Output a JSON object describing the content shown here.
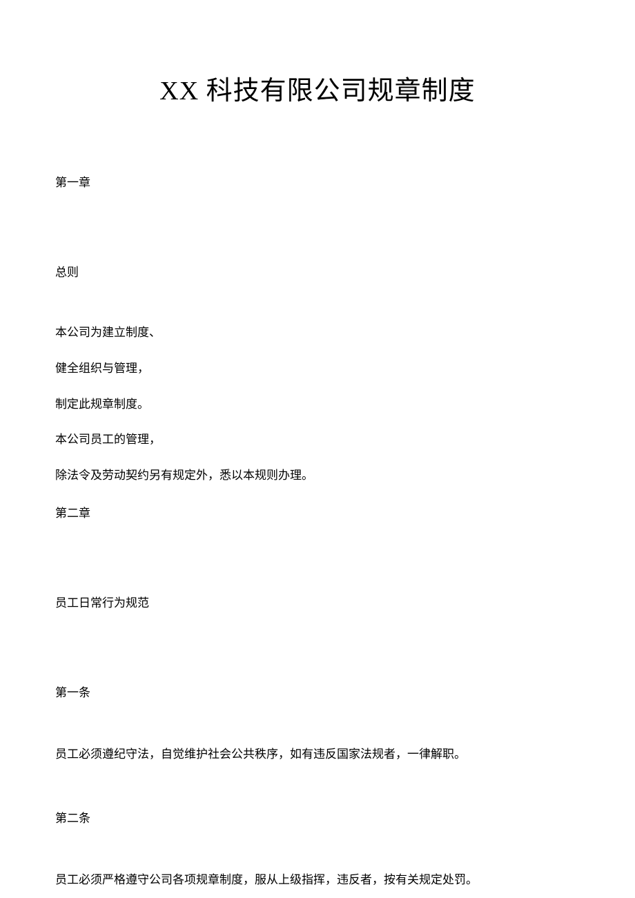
{
  "title": "XX 科技有限公司规章制度",
  "chapter1": {
    "label": "第一章",
    "heading": "总则",
    "lines": [
      "本公司为建立制度、",
      "健全组织与管理，",
      "制定此规章制度。",
      "本公司员工的管理，",
      "除法令及劳动契约另有规定外，悉以本规则办理。"
    ]
  },
  "chapter2": {
    "label": "第二章",
    "heading": "员工日常行为规范",
    "articles": [
      {
        "label": "第一条",
        "text": "员工必须遵纪守法，自觉维护社会公共秩序，如有违反国家法规者，一律解职。"
      },
      {
        "label": "第二条",
        "text": "员工必须严格遵守公司各项规章制度，服从上级指挥，违反者，按有关规定处罚。"
      }
    ]
  }
}
